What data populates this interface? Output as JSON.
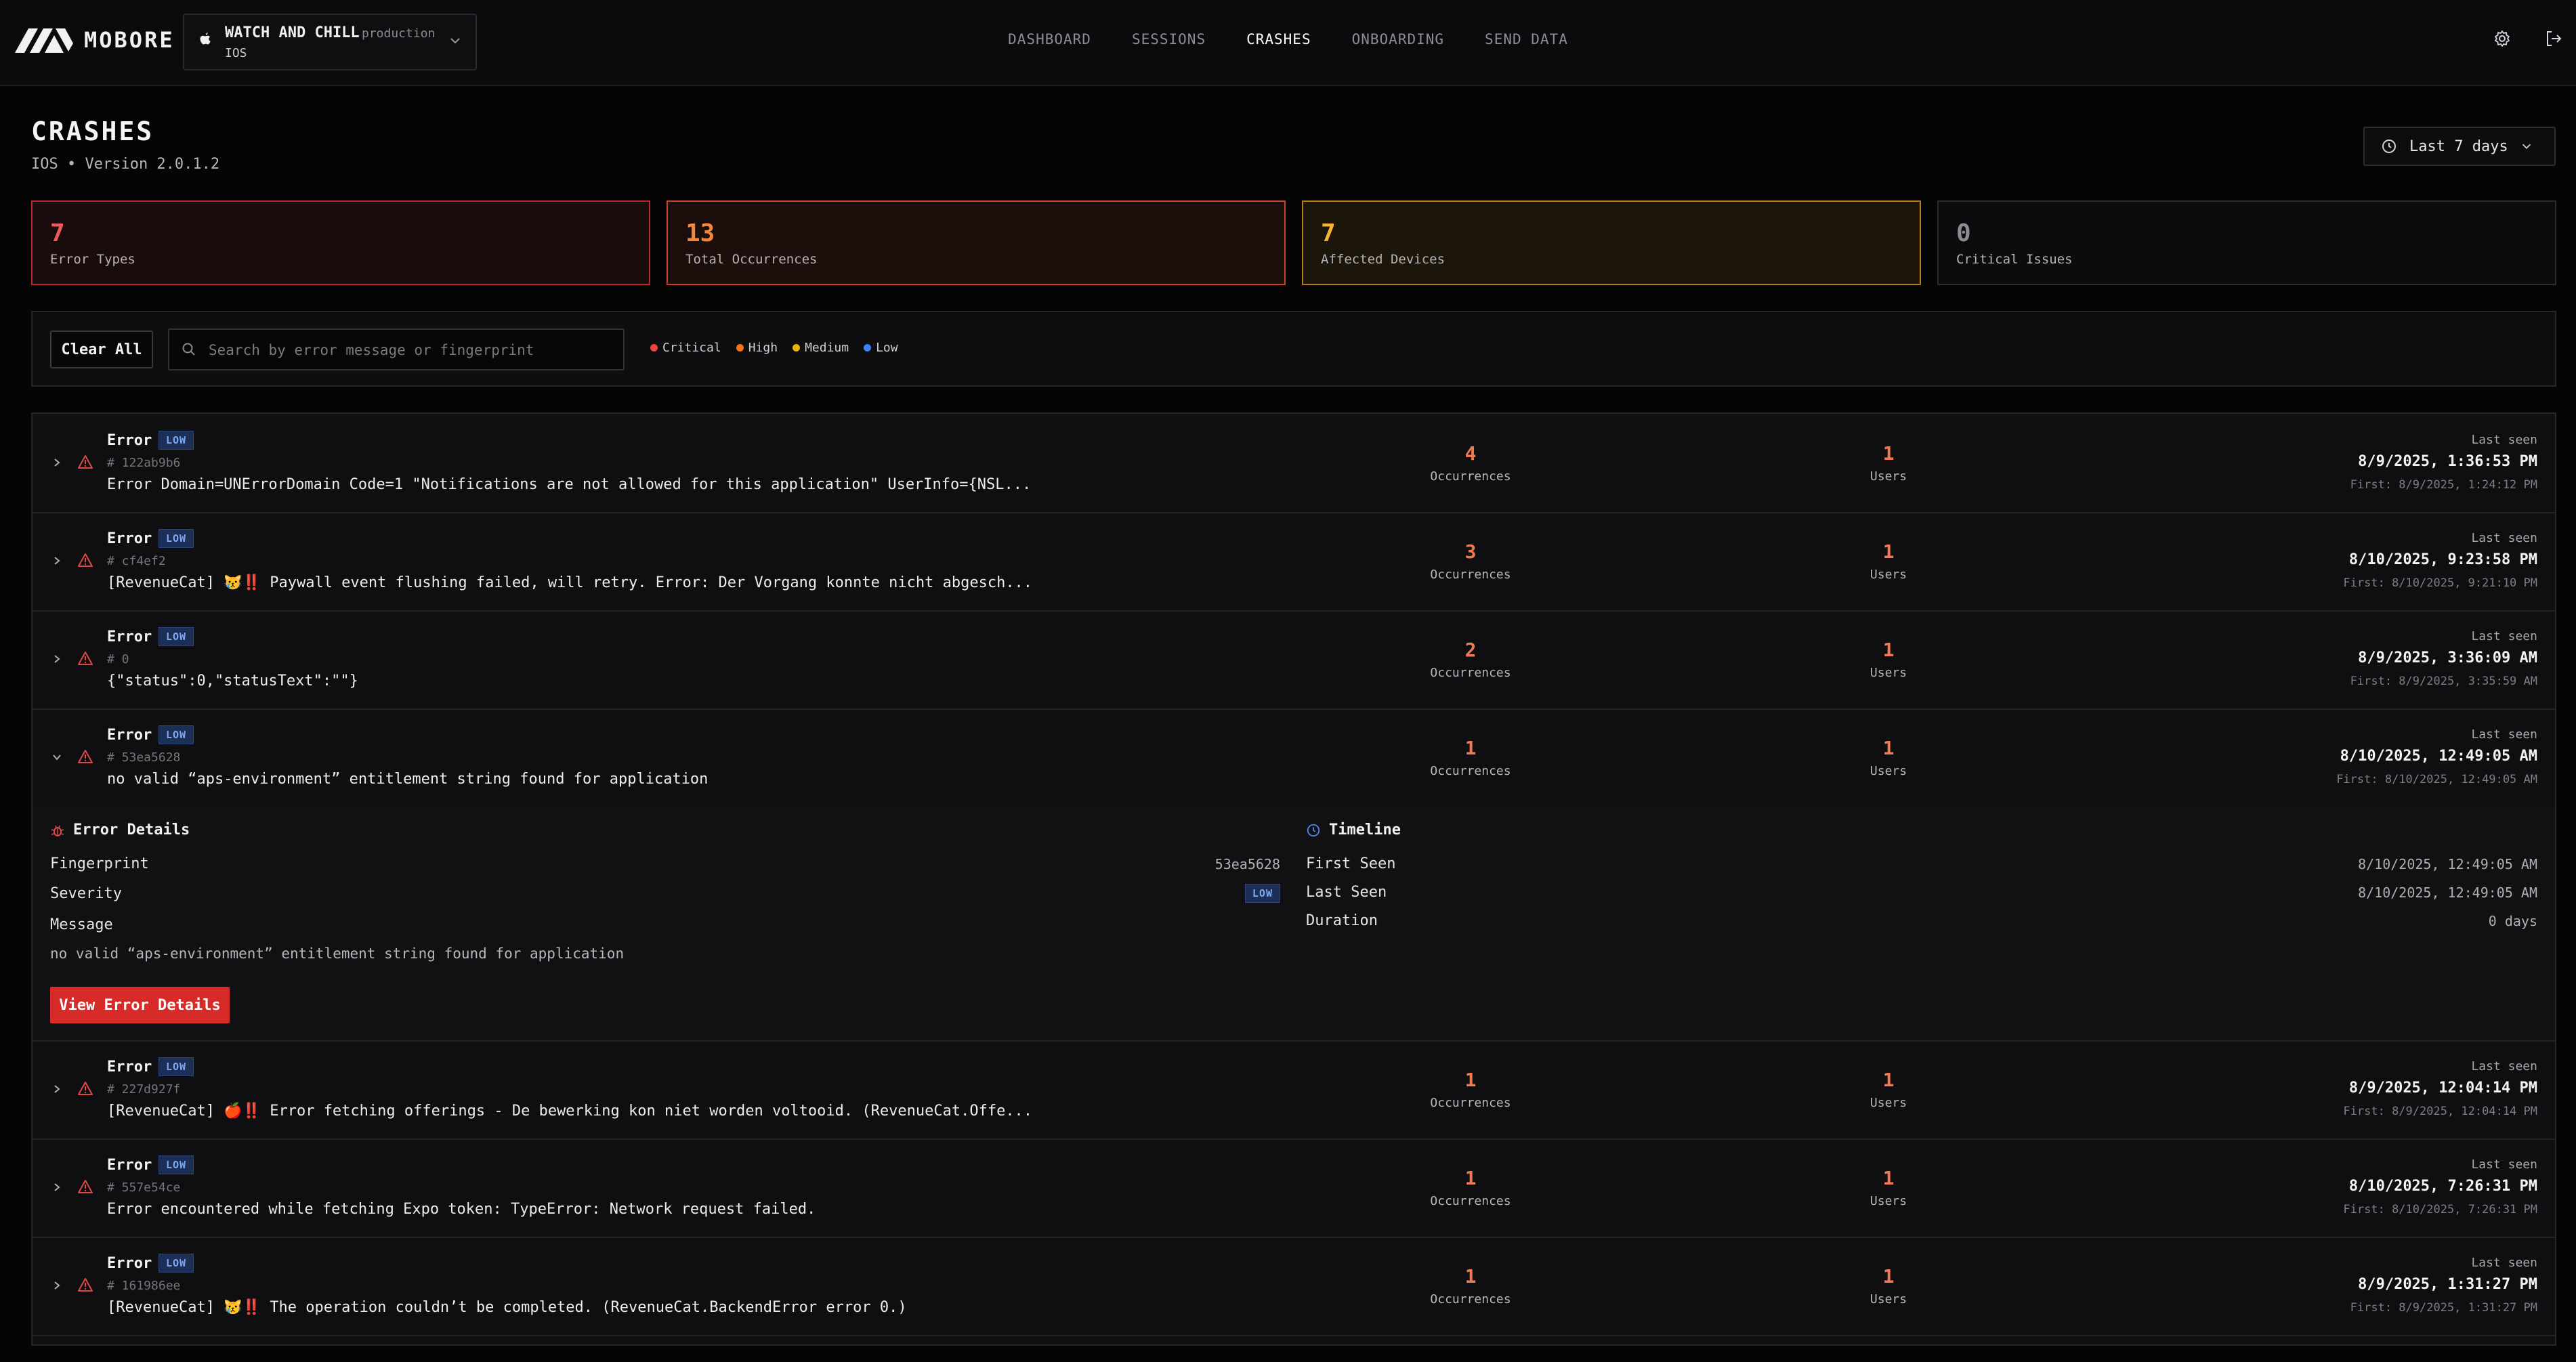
{
  "app": {
    "brand": "MOBORE",
    "project_name": "WATCH AND CHILL",
    "project_env": "production",
    "project_platform": "IOS"
  },
  "nav": {
    "items": [
      {
        "label": "DASHBOARD",
        "active": false
      },
      {
        "label": "SESSIONS",
        "active": false
      },
      {
        "label": "CRASHES",
        "active": true
      },
      {
        "label": "ONBOARDING",
        "active": false
      },
      {
        "label": "SEND DATA",
        "active": false
      }
    ]
  },
  "header": {
    "title": "CRASHES",
    "subtitle": "IOS • Version 2.0.1.2",
    "date_range": "Last 7 days"
  },
  "stats": [
    {
      "value": "7",
      "label": "Error Types"
    },
    {
      "value": "13",
      "label": "Total Occurrences"
    },
    {
      "value": "7",
      "label": "Affected Devices"
    },
    {
      "value": "0",
      "label": "Critical Issues"
    }
  ],
  "filters": {
    "clear_label": "Clear All",
    "search_placeholder": "Search by error message or fingerprint",
    "search_value": "",
    "legend": [
      {
        "label": "Critical",
        "color": "#ef4444"
      },
      {
        "label": "High",
        "color": "#f97316"
      },
      {
        "label": "Medium",
        "color": "#eab308"
      },
      {
        "label": "Low",
        "color": "#3b82f6"
      }
    ]
  },
  "labels": {
    "occurrences": "Occurrences",
    "users": "Users",
    "last_seen": "Last seen",
    "first_prefix": "First: "
  },
  "errors": [
    {
      "type": "Error",
      "severity": "LOW",
      "fingerprint": "# 122ab9b6",
      "message": "Error Domain=UNErrorDomain Code=1 \"Notifications are not allowed for this application\" UserInfo={NSL...",
      "occurrences": "4",
      "users": "1",
      "last_seen": "8/9/2025, 1:36:53 PM",
      "first_seen": "First: 8/9/2025, 1:24:12 PM"
    },
    {
      "type": "Error",
      "severity": "LOW",
      "fingerprint": "# cf4ef2",
      "message": "[RevenueCat] 😿‼️ Paywall event flushing failed, will retry. Error: Der Vorgang konnte nicht abgesch...",
      "occurrences": "3",
      "users": "1",
      "last_seen": "8/10/2025, 9:23:58 PM",
      "first_seen": "First: 8/10/2025, 9:21:10 PM"
    },
    {
      "type": "Error",
      "severity": "LOW",
      "fingerprint": "# 0",
      "message": "{\"status\":0,\"statusText\":\"\"}",
      "occurrences": "2",
      "users": "1",
      "last_seen": "8/9/2025, 3:36:09 AM",
      "first_seen": "First: 8/9/2025, 3:35:59 AM"
    },
    {
      "type": "Error",
      "severity": "LOW",
      "fingerprint": "# 53ea5628",
      "message": "no valid “aps-environment” entitlement string found for application",
      "occurrences": "1",
      "users": "1",
      "last_seen": "8/10/2025, 12:49:05 AM",
      "first_seen": "First: 8/10/2025, 12:49:05 AM"
    },
    {
      "type": "Error",
      "severity": "LOW",
      "fingerprint": "# 227d927f",
      "message": "[RevenueCat] 🍎‼️ Error fetching offerings - De bewerking kon niet worden voltooid. (RevenueCat.Offe...",
      "occurrences": "1",
      "users": "1",
      "last_seen": "8/9/2025, 12:04:14 PM",
      "first_seen": "First: 8/9/2025, 12:04:14 PM"
    },
    {
      "type": "Error",
      "severity": "LOW",
      "fingerprint": "# 557e54ce",
      "message": "Error encountered while fetching Expo token: TypeError: Network request failed.",
      "occurrences": "1",
      "users": "1",
      "last_seen": "8/10/2025, 7:26:31 PM",
      "first_seen": "First: 8/10/2025, 7:26:31 PM"
    },
    {
      "type": "Error",
      "severity": "LOW",
      "fingerprint": "# 161986ee",
      "message": "[RevenueCat] 😿‼️ The operation couldn’t be completed. (RevenueCat.BackendError error 0.)",
      "occurrences": "1",
      "users": "1",
      "last_seen": "8/9/2025, 1:31:27 PM",
      "first_seen": "First: 8/9/2025, 1:31:27 PM"
    }
  ],
  "details": {
    "error_details_title": "Error Details",
    "fingerprint_label": "Fingerprint",
    "fingerprint_value": "53ea5628",
    "severity_label": "Severity",
    "severity_value": "LOW",
    "message_label": "Message",
    "message_value": "no valid “aps-environment” entitlement string found for application",
    "view_button": "View Error Details",
    "timeline_title": "Timeline",
    "first_seen_label": "First Seen",
    "first_seen_value": "8/10/2025, 12:49:05 AM",
    "last_seen_label": "Last Seen",
    "last_seen_value": "8/10/2025, 12:49:05 AM",
    "duration_label": "Duration",
    "duration_value": "0 days"
  }
}
